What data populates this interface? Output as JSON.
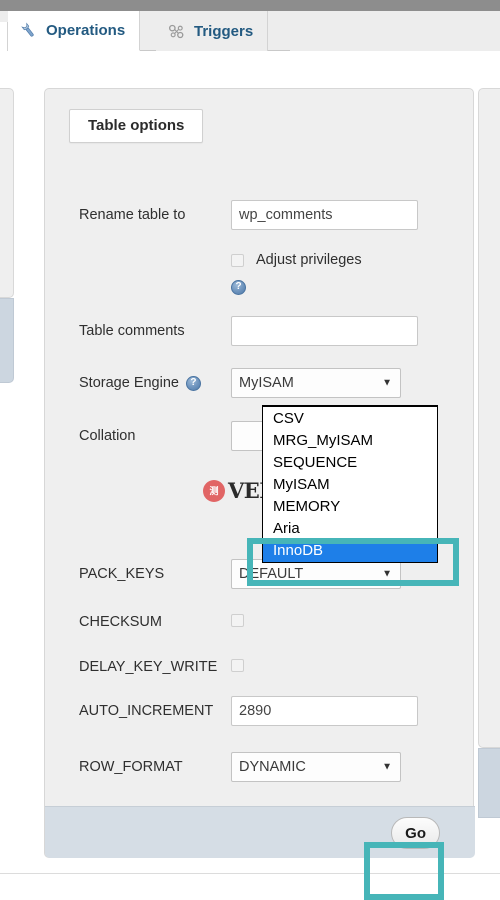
{
  "window": {
    "topbar_color": "#8d8d8d",
    "accent_highlight_color": "#46b5b8",
    "select_highlight_color": "#1e7fe8"
  },
  "tabs": [
    {
      "label": "Operations",
      "icon": "wrench-icon",
      "active": true
    },
    {
      "label": "Triggers",
      "icon": "trigger-icon",
      "active": false
    }
  ],
  "fieldset": {
    "legend": "Table options"
  },
  "form": {
    "rename_table": {
      "label": "Rename table to",
      "value": "wp_comments",
      "placeholder": ""
    },
    "adjust_privileges": {
      "label": "Adjust privileges",
      "checked": false,
      "help_icon": "help-icon"
    },
    "table_comments": {
      "label": "Table comments",
      "value": "",
      "placeholder": ""
    },
    "storage_engine": {
      "label": "Storage Engine",
      "help_icon": "help-icon",
      "value": "MyISAM",
      "options": [
        "CSV",
        "MRG_MyISAM",
        "SEQUENCE",
        "MyISAM",
        "MEMORY",
        "Aria",
        "InnoDB"
      ],
      "highlighted_option": "InnoDB",
      "open": true
    },
    "collation": {
      "label": "Collation",
      "value": ""
    },
    "pack_keys": {
      "label": "PACK_KEYS",
      "value": "DEFAULT"
    },
    "checksum": {
      "label": "CHECKSUM",
      "checked": false
    },
    "delay_key_write": {
      "label": "DELAY_KEY_WRITE",
      "checked": false
    },
    "auto_increment": {
      "label": "AUTO_INCREMENT",
      "value": "2890",
      "placeholder": ""
    },
    "row_format": {
      "label": "ROW_FORMAT",
      "value": "DYNAMIC"
    }
  },
  "footer": {
    "submit_label": "Go"
  },
  "watermark": {
    "seal_text": "测",
    "text": "VEIDC.COM"
  }
}
